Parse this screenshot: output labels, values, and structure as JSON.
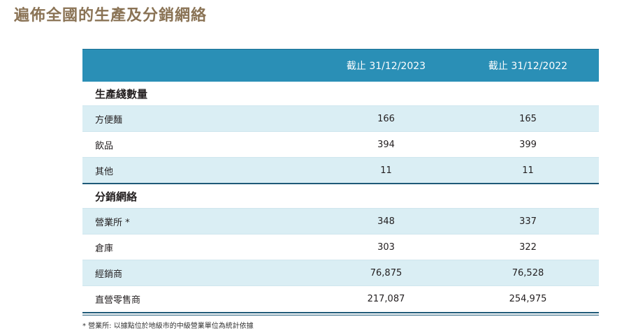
{
  "page": {
    "title": "遍佈全國的生產及分銷網絡"
  },
  "table": {
    "columns": [
      "截止 31/12/2023",
      "截止 31/12/2022"
    ],
    "sections": [
      {
        "title": "生產綫數量",
        "rows": [
          {
            "label": "方便麵",
            "values": [
              "166",
              "165"
            ]
          },
          {
            "label": "飲品",
            "values": [
              "394",
              "399"
            ]
          },
          {
            "label": "其他",
            "values": [
              "11",
              "11"
            ]
          }
        ]
      },
      {
        "title": "分銷網絡",
        "rows": [
          {
            "label": "營業所 *",
            "values": [
              "348",
              "337"
            ]
          },
          {
            "label": "倉庫",
            "values": [
              "303",
              "322"
            ]
          },
          {
            "label": "經銷商",
            "values": [
              "76,875",
              "76,528"
            ]
          },
          {
            "label": "直營零售商",
            "values": [
              "217,087",
              "254,975"
            ]
          }
        ]
      }
    ]
  },
  "footnote": "* 營業所: 以據點位於地級市的中級營業單位為統計依據",
  "colors": {
    "title": "#8a7355",
    "header_bg": "#2a8fb6",
    "row_shade": "#daeef4",
    "rule": "#1f5a78"
  }
}
